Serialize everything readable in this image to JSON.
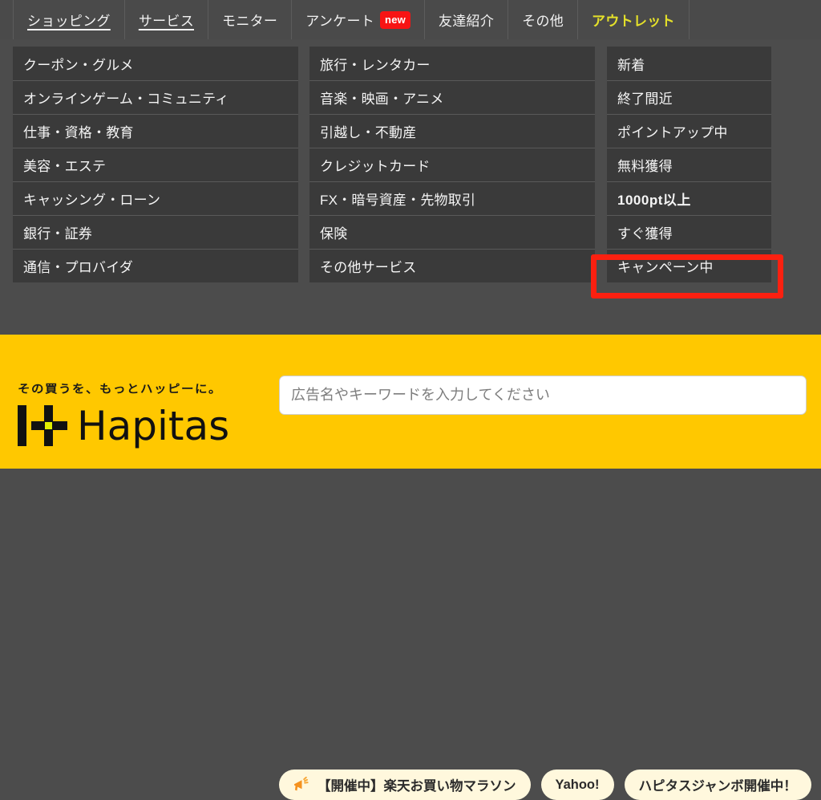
{
  "tabs": [
    {
      "label": "ショッピング",
      "state": "normal",
      "badge": null
    },
    {
      "label": "サービス",
      "state": "current",
      "badge": null
    },
    {
      "label": "モニター",
      "state": "normal",
      "badge": null
    },
    {
      "label": "アンケート",
      "state": "normal",
      "badge": "new"
    },
    {
      "label": "友達紹介",
      "state": "normal",
      "badge": null
    },
    {
      "label": "その他",
      "state": "normal",
      "badge": null
    },
    {
      "label": "アウトレット",
      "state": "accent",
      "badge": null
    }
  ],
  "columns": {
    "left": [
      "クーポン・グルメ",
      "オンラインゲーム・コミュニティ",
      "仕事・資格・教育",
      "美容・エステ",
      "キャッシング・ローン",
      "銀行・証券",
      "通信・プロバイダ"
    ],
    "middle": [
      "旅行・レンタカー",
      "音楽・映画・アニメ",
      "引越し・不動産",
      "クレジットカード",
      "FX・暗号資産・先物取引",
      "保険",
      "その他サービス"
    ],
    "right": [
      "新着",
      "終了間近",
      "ポイントアップ中",
      "無料獲得",
      "1000pt以上",
      "すぐ獲得",
      "キャンペーン中"
    ]
  },
  "highlight": {
    "target_label": "すぐ獲得",
    "color": "#fb2010"
  },
  "footer": {
    "tagline": "その買うを、もっとハッピーに。",
    "logo_text": "Hapitas",
    "logo_mark_name": "hapitas-plus-logo",
    "search": {
      "placeholder": "広告名やキーワードを入力してください",
      "value": ""
    },
    "tags": [
      {
        "label": "【開催中】楽天お買い物マラソン",
        "icon": "megaphone-icon"
      },
      {
        "label": "Yahoo!",
        "icon": null
      },
      {
        "label": "ハピタスジャンボ開催中！",
        "icon": null
      }
    ]
  },
  "colors": {
    "page_background": "#4c4c4c",
    "tile_background": "#3a3a3a",
    "footer_yellow": "#ffc800",
    "accent_tab": "#e4e02a",
    "badge_red": "#f71414",
    "highlight_red": "#fb2010"
  }
}
